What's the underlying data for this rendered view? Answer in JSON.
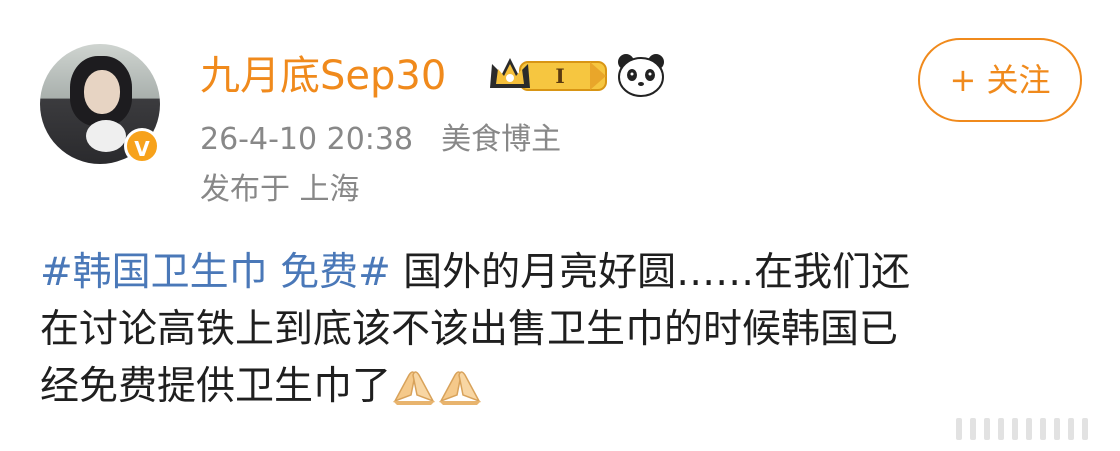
{
  "post": {
    "author": {
      "name": "九月底Sep30",
      "verified_badge_symbol": "V",
      "badges": [
        "crown-level-badge-icon",
        "panda-icon"
      ],
      "crown_level": "I",
      "avatar_icon": "avatar-photo"
    },
    "timestamp": "26-4-10 20:38",
    "category": "美食博主",
    "location": "发布于 上海",
    "follow_button_label": "+ 关注",
    "hashtag": "#韩国卫生巾 免费#",
    "text_lines": [
      "国外的月亮好圆……在我们还",
      "在讨论高铁上到底该不该出售卫生巾的时候韩国已",
      "经免费提供卫生巾了"
    ],
    "trailing_emoji": [
      "folded-hands-emoji",
      "folded-hands-emoji"
    ]
  },
  "colors": {
    "accent_orange": "#f08a1c",
    "hashtag_blue": "#4a78b8",
    "meta_gray": "#888888",
    "verified_badge": "#f7a21b"
  }
}
